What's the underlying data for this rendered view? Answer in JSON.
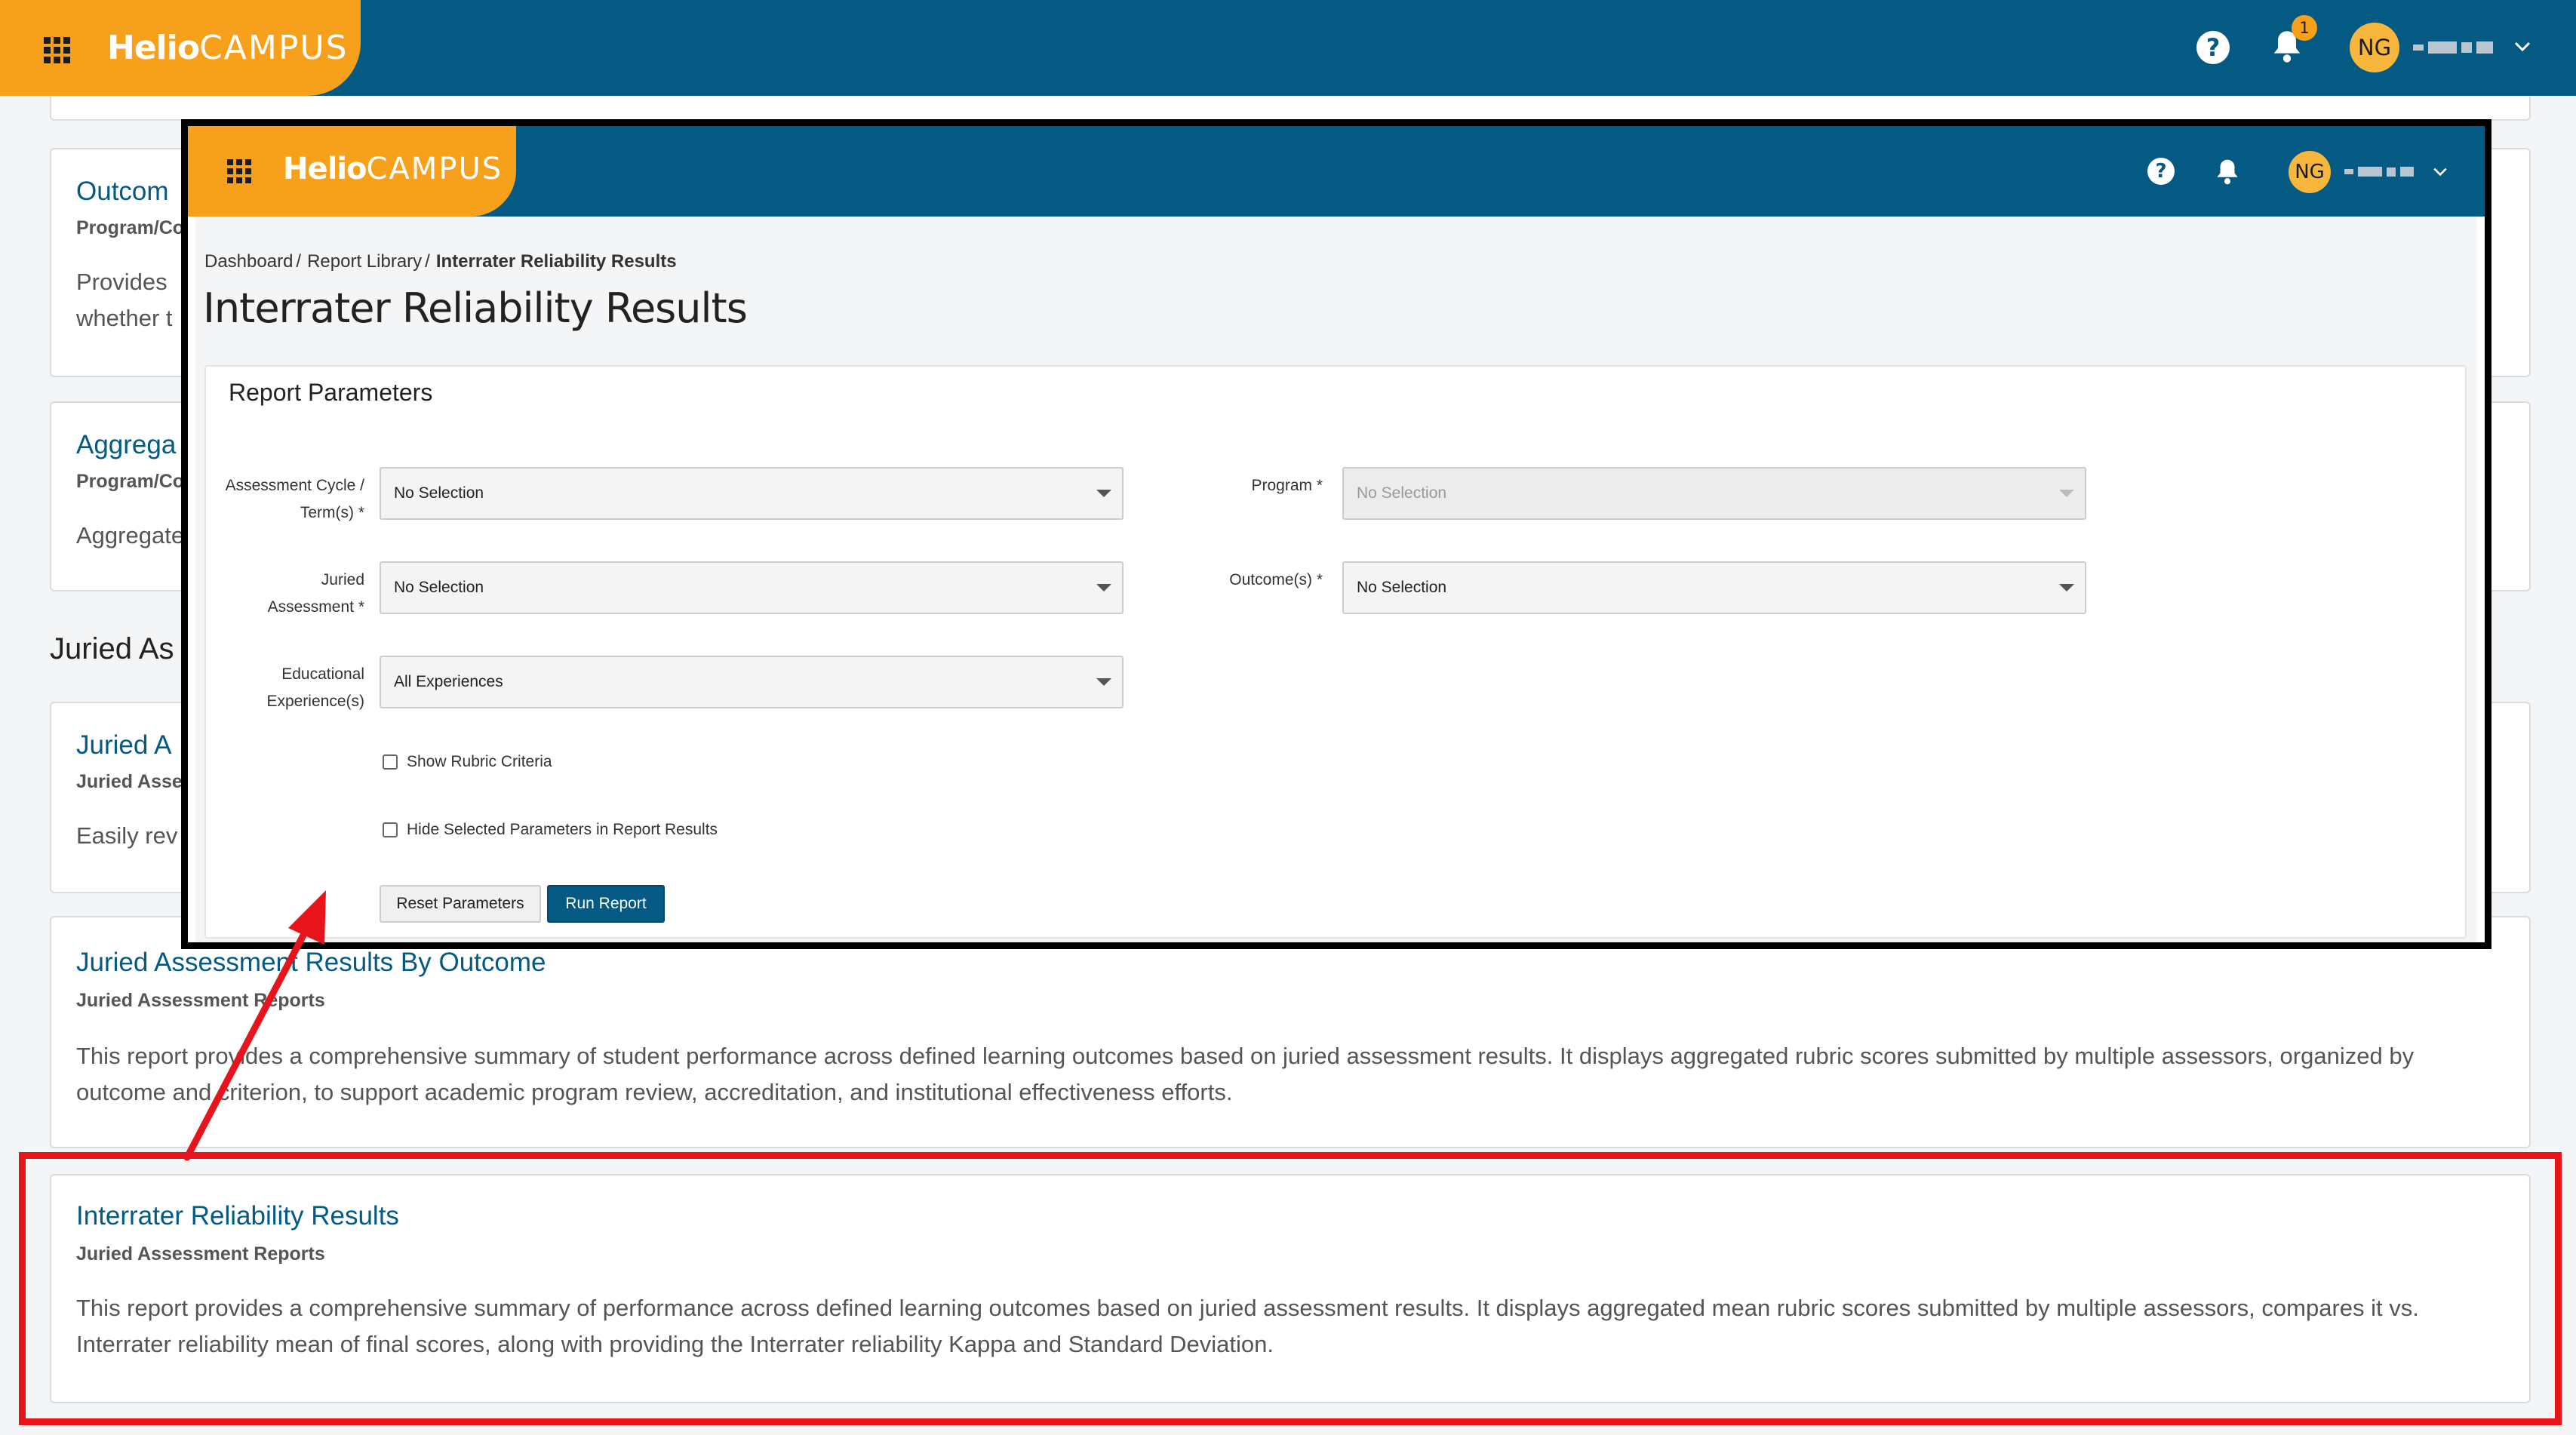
{
  "header": {
    "brand_a": "Helio",
    "brand_b": "CAMPUS",
    "help_icon_glyph": "?",
    "notification_count": "1",
    "avatar_initials": "NG",
    "icons": [
      "apps-grid-icon",
      "help-icon",
      "bell-icon",
      "chevron-down-icon"
    ],
    "colors": {
      "navy": "#045a82",
      "orange": "#f7a01c",
      "avatar": "#f6b73c"
    }
  },
  "background": {
    "cards": [
      {
        "title": "Outcom",
        "sub": "Program/Co",
        "desc": "Provides\nwhether t"
      },
      {
        "title": "Aggrega",
        "sub": "Program/Co",
        "desc": "Aggregate"
      }
    ],
    "section_heading": "Juried As",
    "juried_card": {
      "title": "Juried A",
      "sub": "Juried Asse",
      "desc": "Easily rev"
    },
    "outcome_card": {
      "title": "Juried Assessment Results By Outcome",
      "sub": "Juried Assessment Reports",
      "desc": "This report provides a comprehensive summary of student performance across defined learning outcomes based on juried assessment results. It displays aggregated rubric scores submitted by multiple assessors, organized by outcome and criterion, to support academic program review, accreditation, and institutional effectiveness efforts."
    },
    "irr_card": {
      "title": "Interrater Reliability Results",
      "sub": "Juried Assessment Reports",
      "desc": "This report provides a comprehensive summary of performance across defined learning outcomes based on juried assessment results. It displays aggregated mean rubric scores submitted by multiple assessors, compares it vs. Interrater reliability mean of final scores, along with providing the Interrater reliability Kappa and Standard Deviation."
    }
  },
  "inset": {
    "breadcrumbs": {
      "dashboard": "Dashboard",
      "library": "Report Library",
      "sep": "/",
      "current": "Interrater Reliability Results"
    },
    "page_title": "Interrater Reliability Results",
    "panel_title": "Report Parameters",
    "fields": {
      "cycle": {
        "label1": "Assessment Cycle /",
        "label2": "Term(s) *",
        "value": "No Selection"
      },
      "program": {
        "label": "Program *",
        "value": "No Selection"
      },
      "juried": {
        "label1": "Juried",
        "label2": "Assessment *",
        "value": "No Selection"
      },
      "outcomes": {
        "label": "Outcome(s) *",
        "value": "No Selection"
      },
      "experience": {
        "label1": "Educational",
        "label2": "Experience(s)",
        "value": "All Experiences"
      }
    },
    "checkboxes": {
      "rubric": "Show Rubric Criteria",
      "hide_params": "Hide Selected Parameters in Report Results"
    },
    "buttons": {
      "reset": "Reset Parameters",
      "run": "Run Report"
    }
  }
}
